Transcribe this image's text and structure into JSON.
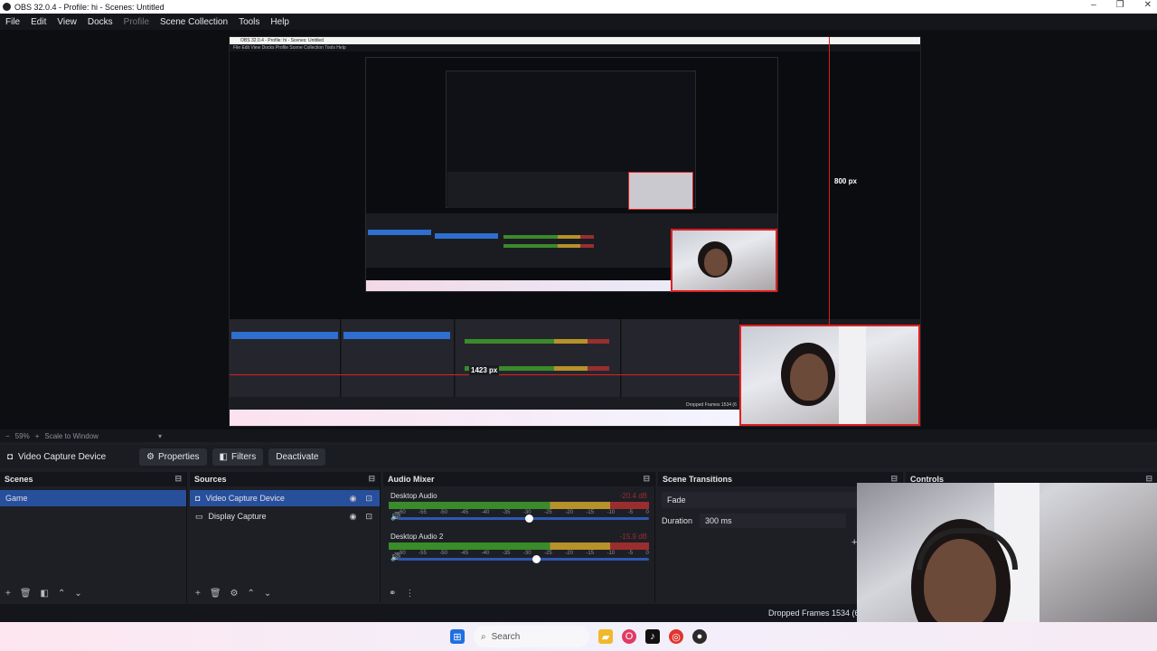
{
  "window": {
    "title": "OBS 32.0.4 - Profile: hi - Scenes: Untitled",
    "controls": [
      "–",
      "❐",
      "✕"
    ]
  },
  "menu": [
    "File",
    "Edit",
    "View",
    "Docks",
    "Profile",
    "Scene Collection",
    "Tools",
    "Help"
  ],
  "preview": {
    "inner_title": "OBS 32.0.4 - Profile: hi - Scenes: Untitled",
    "inner_menu": "File  Edit  View  Docks  Profile  Scene Collection  Tools  Help",
    "label_800": "800 px",
    "label_1423": "1423 px",
    "inner_dropped": "Dropped Frames 1534 (6"
  },
  "scale": {
    "zoom": "59%",
    "scale_mode": "Scale to Window"
  },
  "source_bar": {
    "selected": "Video Capture Device",
    "properties": "Properties",
    "filters": "Filters",
    "deactivate": "Deactivate"
  },
  "scenes": {
    "title": "Scenes",
    "items": [
      "Game"
    ]
  },
  "sources": {
    "title": "Sources",
    "items": [
      "Video Capture Device",
      "Display Capture"
    ]
  },
  "audio_mixer": {
    "title": "Audio Mixer",
    "tracks": [
      {
        "name": "Desktop Audio",
        "db": "-20.4 dB",
        "level": 0.52
      },
      {
        "name": "Desktop Audio 2",
        "db": "-15.9 dB",
        "level": 0.55
      }
    ],
    "ticks": [
      "-60",
      "-55",
      "-50",
      "-45",
      "-40",
      "-35",
      "-30",
      "-25",
      "-20",
      "-15",
      "-10",
      "-5",
      "0"
    ]
  },
  "transitions": {
    "title": "Scene Transitions",
    "type": "Fade",
    "duration_label": "Duration",
    "duration_value": "300 ms"
  },
  "controls_dock": {
    "title": "Controls"
  },
  "status": {
    "dropped": "Dropped Frames 1534 (6."
  },
  "taskbar": {
    "search": "Search"
  }
}
